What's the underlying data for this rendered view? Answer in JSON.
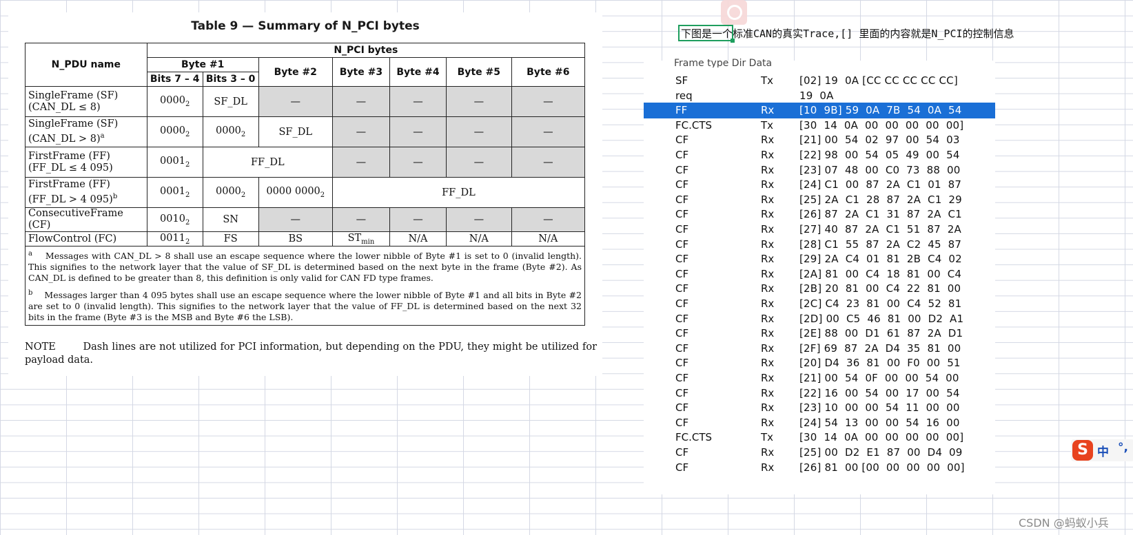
{
  "table": {
    "title": "Table 9 — Summary of N_PCI bytes",
    "headers": {
      "pdu_name": "N_PDU name",
      "npci": "N_PCI bytes",
      "byte1": "Byte #1",
      "bits74": "Bits 7 – 4",
      "bits30": "Bits 3 – 0",
      "byte2": "Byte #2",
      "byte3": "Byte #3",
      "byte4": "Byte #4",
      "byte5": "Byte #5",
      "byte6": "Byte #6"
    },
    "rows": {
      "sf1_name1": "SingleFrame (SF)",
      "sf1_name2": "(CAN_DL ≤ 8)",
      "sf1_b74": "0000",
      "sf1_b30": "SF_DL",
      "sf2_name1": "SingleFrame (SF)",
      "sf2_name2": "(CAN_DL > 8)",
      "sf2_sup": "a",
      "sf2_b74": "0000",
      "sf2_b30": "0000",
      "sf2_b2": "SF_DL",
      "ff1_name1": "FirstFrame (FF)",
      "ff1_name2": "(FF_DL ≤ 4 095)",
      "ff1_b74": "0001",
      "ff1_b30": "FF_DL",
      "ff2_name1": "FirstFrame (FF)",
      "ff2_name2": "(FF_DL > 4 095)",
      "ff2_sup": "b",
      "ff2_b74": "0001",
      "ff2_b30": "0000",
      "ff2_b2": "0000 0000",
      "ff2_rest": "FF_DL",
      "cf_name": "ConsecutiveFrame (CF)",
      "cf_b74": "0010",
      "cf_b30": "SN",
      "fc_name": "FlowControl (FC)",
      "fc_b74": "0011",
      "fc_b30": "FS",
      "fc_b2": "BS",
      "fc_b3": "ST",
      "fc_b3_sub": "min",
      "fc_b4": "N/A",
      "fc_b5": "N/A",
      "fc_b6": "N/A",
      "dash": "—",
      "base": "2"
    },
    "footnote_a_mark": "a",
    "footnote_a": "Messages with CAN_DL > 8 shall use an escape sequence where the lower nibble of Byte #1 is set to 0 (invalid length). This signifies to the network layer that the value of SF_DL is determined based on the next byte in the frame (Byte #2). As CAN_DL is defined to be greater than 8, this definition is only valid for CAN FD type frames.",
    "footnote_b_mark": "b",
    "footnote_b": "Messages larger than 4 095 bytes shall use an escape sequence where the lower nibble of Byte #1 and all bits in Byte #2 are set to 0 (invalid length). This signifies to the network layer that the value of FF_DL is determined based on the next 32 bits in the frame (Byte #3 is the MSB and Byte #6 the LSB).",
    "note_label": "NOTE",
    "note_text": "Dash lines are not utilized for PCI information, but depending on the PDU, they might be utilized for payload data."
  },
  "heading": "下图是一个标准CAN的真实Trace,[] 里面的内容就是N_PCI的控制信息",
  "trace": {
    "header_cut": "Frame type      Dir      Data",
    "rows": [
      {
        "t": "SF",
        "d": "Tx",
        "data": "[02] 19  0A [CC CC CC CC CC]"
      },
      {
        "t": "req",
        "d": "",
        "data": "19  0A"
      },
      {
        "t": "FF",
        "d": "Rx",
        "data": "[10  9B] 59  0A  7B  54  0A  54",
        "sel": true
      },
      {
        "t": "FC.CTS",
        "d": "Tx",
        "data": "[30  14  0A  00  00  00  00  00]"
      },
      {
        "t": "CF",
        "d": "Rx",
        "data": "[21] 00  54  02  97  00  54  03"
      },
      {
        "t": "CF",
        "d": "Rx",
        "data": "[22] 98  00  54  05  49  00  54"
      },
      {
        "t": "CF",
        "d": "Rx",
        "data": "[23] 07  48  00  C0  73  88  00"
      },
      {
        "t": "CF",
        "d": "Rx",
        "data": "[24] C1  00  87  2A  C1  01  87"
      },
      {
        "t": "CF",
        "d": "Rx",
        "data": "[25] 2A  C1  28  87  2A  C1  29"
      },
      {
        "t": "CF",
        "d": "Rx",
        "data": "[26] 87  2A  C1  31  87  2A  C1"
      },
      {
        "t": "CF",
        "d": "Rx",
        "data": "[27] 40  87  2A  C1  51  87  2A"
      },
      {
        "t": "CF",
        "d": "Rx",
        "data": "[28] C1  55  87  2A  C2  45  87"
      },
      {
        "t": "CF",
        "d": "Rx",
        "data": "[29] 2A  C4  01  81  2B  C4  02"
      },
      {
        "t": "CF",
        "d": "Rx",
        "data": "[2A] 81  00  C4  18  81  00  C4"
      },
      {
        "t": "CF",
        "d": "Rx",
        "data": "[2B] 20  81  00  C4  22  81  00"
      },
      {
        "t": "CF",
        "d": "Rx",
        "data": "[2C] C4  23  81  00  C4  52  81"
      },
      {
        "t": "CF",
        "d": "Rx",
        "data": "[2D] 00  C5  46  81  00  D2  A1"
      },
      {
        "t": "CF",
        "d": "Rx",
        "data": "[2E] 88  00  D1  61  87  2A  D1"
      },
      {
        "t": "CF",
        "d": "Rx",
        "data": "[2F] 69  87  2A  D4  35  81  00"
      },
      {
        "t": "CF",
        "d": "Rx",
        "data": "[20] D4  36  81  00  F0  00  51"
      },
      {
        "t": "CF",
        "d": "Rx",
        "data": "[21] 00  54  0F  00  00  54  00"
      },
      {
        "t": "CF",
        "d": "Rx",
        "data": "[22] 16  00  54  00  17  00  54"
      },
      {
        "t": "CF",
        "d": "Rx",
        "data": "[23] 10  00  00  54  11  00  00"
      },
      {
        "t": "CF",
        "d": "Rx",
        "data": "[24] 54  13  00  00  54  16  00"
      },
      {
        "t": "FC.CTS",
        "d": "Tx",
        "data": "[30  14  0A  00  00  00  00  00]"
      },
      {
        "t": "CF",
        "d": "Rx",
        "data": "[25] 00  D2  E1  87  00  D4  09"
      },
      {
        "t": "CF",
        "d": "Rx",
        "data": "[26] 81  00 [00  00  00  00  00]"
      }
    ]
  },
  "ime": {
    "logo": "S",
    "mode": "中",
    "punct": "°,"
  },
  "watermark": "CSDN @蚂蚁小兵",
  "colors": {
    "selection": "#1a6fd6",
    "cell_cursor": "#1e9e5e",
    "gray_cell": "#d9d9d9"
  }
}
